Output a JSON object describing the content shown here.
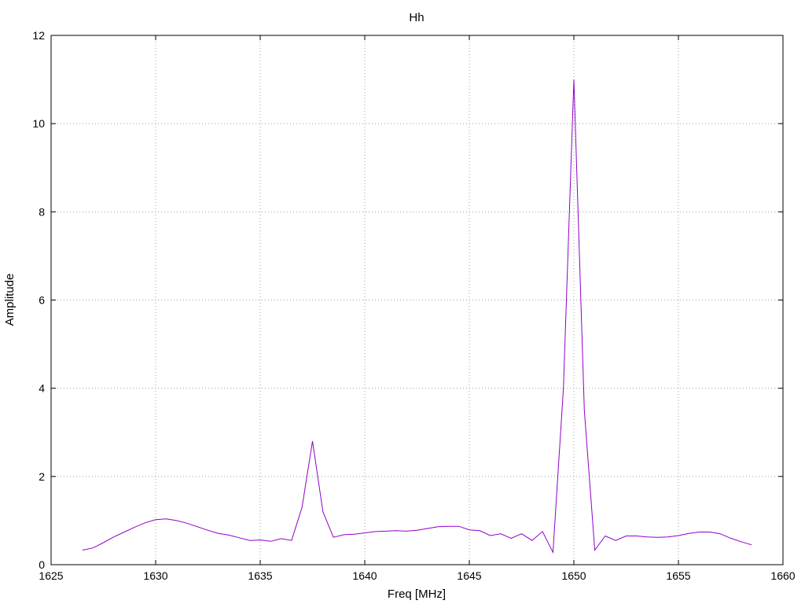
{
  "chart_data": {
    "type": "line",
    "title": "Hh",
    "xlabel": "Freq [MHz]",
    "ylabel": "Amplitude",
    "xlim": [
      1625,
      1660
    ],
    "ylim": [
      0,
      12
    ],
    "xticks": [
      "1625",
      "1630",
      "1635",
      "1640",
      "1645",
      "1650",
      "1655",
      "1660"
    ],
    "yticks": [
      "0",
      "2",
      "4",
      "6",
      "8",
      "10",
      "12"
    ],
    "grid": true,
    "legend": "none",
    "series": [
      {
        "color": "#8f00c8",
        "x": [
          1626.5,
          1627.0,
          1627.5,
          1628.0,
          1628.5,
          1629.0,
          1629.5,
          1630.0,
          1630.5,
          1631.0,
          1631.5,
          1632.0,
          1632.5,
          1633.0,
          1633.5,
          1634.0,
          1634.5,
          1635.0,
          1635.5,
          1636.0,
          1636.5,
          1637.0,
          1637.5,
          1638.0,
          1638.5,
          1639.0,
          1639.5,
          1640.0,
          1640.5,
          1641.0,
          1641.5,
          1642.0,
          1642.5,
          1643.0,
          1643.5,
          1644.0,
          1644.5,
          1645.0,
          1645.5,
          1646.0,
          1646.5,
          1647.0,
          1647.5,
          1648.0,
          1648.5,
          1649.0,
          1649.5,
          1650.0,
          1650.5,
          1651.0,
          1651.5,
          1652.0,
          1652.5,
          1653.0,
          1653.5,
          1654.0,
          1654.5,
          1655.0,
          1655.5,
          1656.0,
          1656.5,
          1657.0,
          1657.5,
          1658.0,
          1658.5
        ],
        "y": [
          0.33,
          0.38,
          0.5,
          0.63,
          0.74,
          0.85,
          0.95,
          1.02,
          1.04,
          1.0,
          0.94,
          0.86,
          0.78,
          0.71,
          0.67,
          0.61,
          0.55,
          0.56,
          0.53,
          0.59,
          0.55,
          1.3,
          2.8,
          1.2,
          0.62,
          0.68,
          0.69,
          0.72,
          0.75,
          0.76,
          0.77,
          0.76,
          0.78,
          0.82,
          0.86,
          0.87,
          0.87,
          0.79,
          0.77,
          0.66,
          0.7,
          0.6,
          0.7,
          0.55,
          0.75,
          0.28,
          4.0,
          11.0,
          3.5,
          0.33,
          0.65,
          0.55,
          0.65,
          0.65,
          0.63,
          0.62,
          0.63,
          0.66,
          0.71,
          0.74,
          0.74,
          0.7,
          0.6,
          0.52,
          0.45
        ]
      }
    ]
  }
}
